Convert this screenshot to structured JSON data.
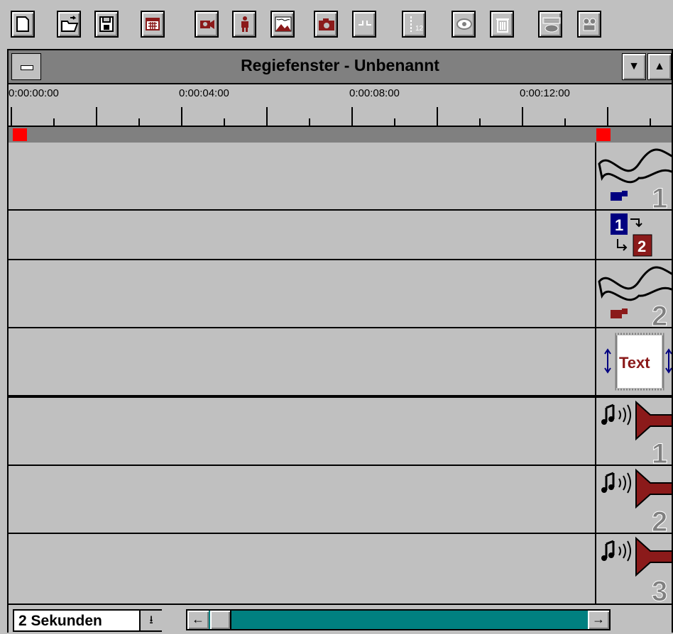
{
  "toolbar": {
    "buttons": [
      {
        "name": "new-button",
        "icon": "new-document-icon"
      },
      {
        "name": "open-button",
        "icon": "open-folder-icon"
      },
      {
        "name": "save-button",
        "icon": "save-disk-icon"
      },
      {
        "name": "calendar-button",
        "icon": "calendar-icon"
      },
      {
        "name": "video-camera-button",
        "icon": "video-camera-icon"
      },
      {
        "name": "figure-button",
        "icon": "figure-icon"
      },
      {
        "name": "image-button",
        "icon": "image-icon"
      },
      {
        "name": "photo-camera-button",
        "icon": "photo-camera-icon"
      },
      {
        "name": "split-button",
        "icon": "split-icon"
      },
      {
        "name": "numbered-button",
        "icon": "numbered-track-icon"
      },
      {
        "name": "view-button",
        "icon": "eye-icon"
      },
      {
        "name": "trash-button",
        "icon": "trash-icon"
      },
      {
        "name": "keyboard-button",
        "icon": "keyboard-icon"
      },
      {
        "name": "projector-button",
        "icon": "projector-icon"
      }
    ]
  },
  "window": {
    "title": "Regiefenster - Unbenannt"
  },
  "ruler": {
    "labels": [
      "0:00:00:00",
      "0:00:04:00",
      "0:00:08:00",
      "0:00:12:00"
    ]
  },
  "tracks": [
    {
      "name": "video-track-1",
      "icon": "video-filmstrip-icon",
      "number": "1"
    },
    {
      "name": "transition-track",
      "icon": "transition-icon",
      "label_a": "1",
      "label_b": "2"
    },
    {
      "name": "video-track-2",
      "icon": "video-filmstrip-icon",
      "number": "2"
    },
    {
      "name": "text-track",
      "icon": "text-scroll-icon",
      "label": "Text"
    },
    {
      "name": "audio-track-1",
      "icon": "audio-speaker-icon",
      "number": "1"
    },
    {
      "name": "audio-track-2",
      "icon": "audio-speaker-icon",
      "number": "2"
    },
    {
      "name": "audio-track-3",
      "icon": "audio-speaker-icon",
      "number": "3"
    }
  ],
  "bottom": {
    "zoom_value": "2 Sekunden"
  },
  "colors": {
    "accent_red": "#8b1a1a",
    "marker_red": "#ff0000",
    "scroll_teal": "#008080",
    "blue": "#000080"
  }
}
